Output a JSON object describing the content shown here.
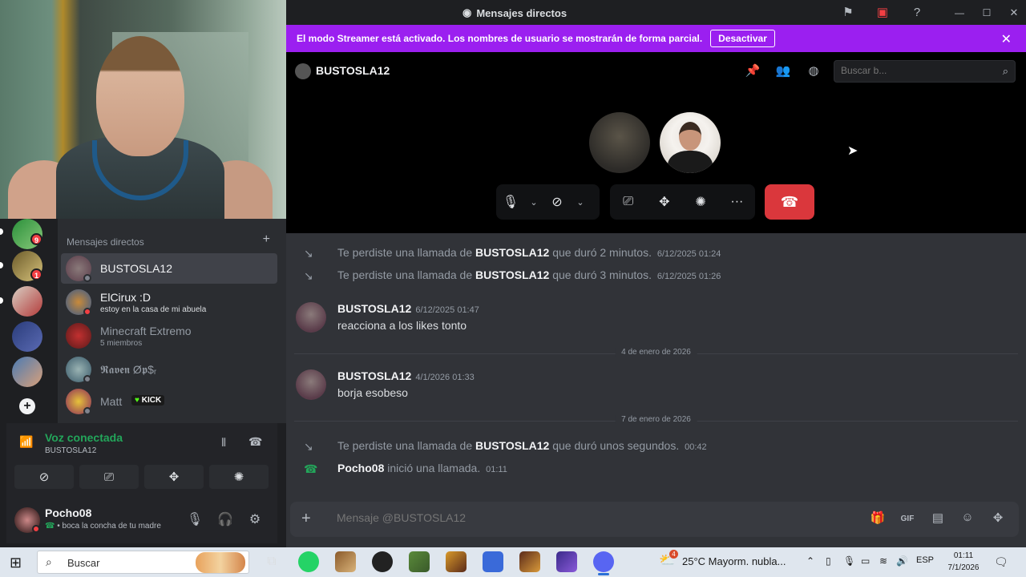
{
  "window": {
    "title": "Mensajes directos",
    "icons": [
      "inbox-flag-icon",
      "screen-share-icon",
      "help-icon"
    ],
    "controls": [
      "minimize",
      "maximize",
      "close"
    ]
  },
  "banner": {
    "text": "El modo Streamer está activado. Los nombres de usuario se mostrarán de forma parcial.",
    "button": "Desactivar",
    "close": "✕"
  },
  "call_header": {
    "name": "BUSTOSLA12",
    "search_placeholder": "Buscar b..."
  },
  "call_controls": {
    "icons": [
      "microphone-icon",
      "chevron-down-icon",
      "camera-off-icon",
      "chevron-down-icon",
      "screen-share-icon",
      "activities-icon",
      "soundboard-icon",
      "more-icon",
      "hang-up-icon"
    ]
  },
  "sidebar": {
    "header": "Mensajes directos",
    "guild_badges": [
      "9",
      "1",
      ""
    ],
    "dms": [
      {
        "name": "BUSTOSLA12",
        "sub": "",
        "active": true
      },
      {
        "name": "ElCirux :D",
        "sub": "estoy en la casa de mi abuela",
        "active": false
      },
      {
        "name": "Minecraft Extremo",
        "sub": "5 miembros",
        "active": false
      },
      {
        "name": "𝕽𝖆𝖛𝖊𝖓 Ø𝖕$ᵣ",
        "sub": "",
        "active": false
      },
      {
        "name": "Matt",
        "sub": "",
        "active": false,
        "tag": "KICK"
      }
    ]
  },
  "voice": {
    "status": "Voz conectada",
    "channel": "BUSTOSLA12"
  },
  "user": {
    "name": "Pocho08",
    "status": "• boca la concha de tu madre"
  },
  "chat": {
    "events": [
      {
        "type": "missed",
        "prefix": "Te perdiste una llamada de",
        "who": "BUSTOSLA12",
        "suffix": "que duró 2 minutos.",
        "time": "6/12/2025 01:24"
      },
      {
        "type": "missed",
        "prefix": "Te perdiste una llamada de",
        "who": "BUSTOSLA12",
        "suffix": "que duró 3 minutos.",
        "time": "6/12/2025 01:26"
      }
    ],
    "msg1": {
      "author": "BUSTOSLA12",
      "time": "6/12/2025 01:47",
      "body": "reacciona a los likes tonto"
    },
    "divider1": "4 de enero de 2026",
    "msg2": {
      "author": "BUSTOSLA12",
      "time": "4/1/2026 01:33",
      "body": "borja esobeso"
    },
    "divider2": "7 de enero de 2026",
    "missed3": {
      "prefix": "Te perdiste una llamada de",
      "who": "BUSTOSLA12",
      "suffix": "que duró unos segundos.",
      "time": "00:42"
    },
    "started": {
      "who": "Pocho08",
      "suffix": "inició una llamada.",
      "time": "01:11"
    },
    "composer_placeholder": "Mensaje @BUSTOSLA12"
  },
  "taskbar": {
    "search": "Buscar",
    "weather": "25°C  Mayorm. nubla...",
    "weather_badge": "4",
    "lang": "ESP",
    "time": "01:11",
    "date": "7/1/2026"
  },
  "colors": {
    "banner": "#9b1ff0",
    "hangup": "#da373c",
    "online": "#23a55a"
  }
}
